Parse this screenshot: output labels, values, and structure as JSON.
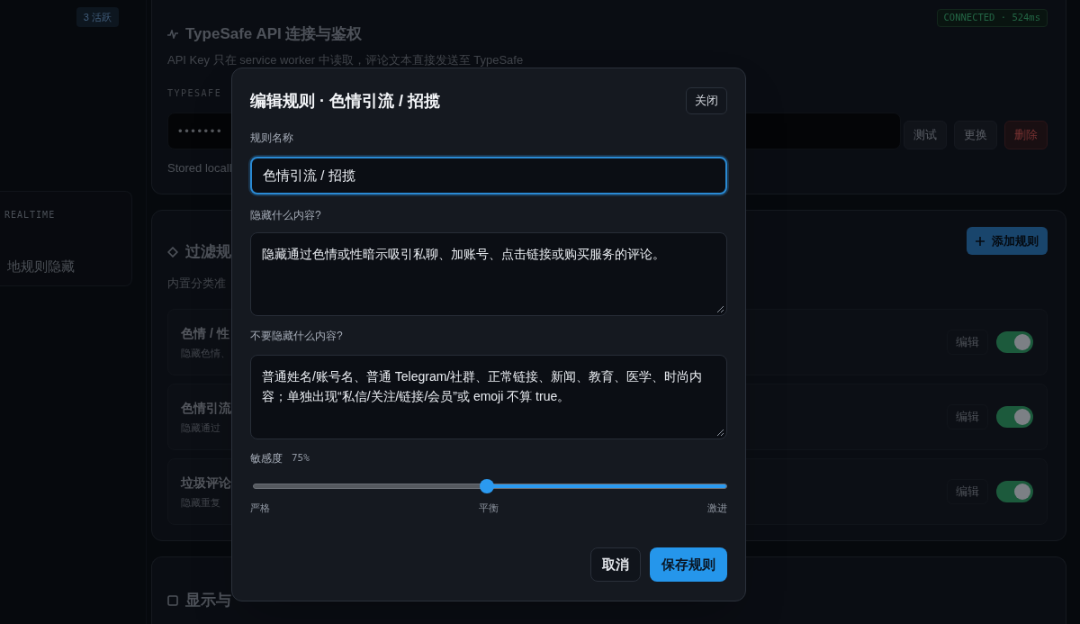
{
  "sidebar": {
    "badge": "3 活跃",
    "card": {
      "tag": "REALTIME",
      "title": "地规则隐藏"
    }
  },
  "api_card": {
    "title": "TypeSafe API 连接与鉴权",
    "status": "CONNECTED · 524ms",
    "description": "API Key 只在 service worker 中读取，评论文本直接发送至 TypeSafe",
    "key_label": "TYPESAFE",
    "key_value": "•••••••",
    "buttons": [
      {
        "label": "测试",
        "kind": "default"
      },
      {
        "label": "更换",
        "kind": "default"
      },
      {
        "label": "删除",
        "kind": "danger"
      }
    ],
    "note": "Stored locall"
  },
  "rules_card": {
    "title": "过滤规",
    "description": "内置分类准",
    "add_button": "添加规则",
    "rules": [
      {
        "title": "色情 / 性",
        "summary": "隐藏色情、",
        "edit": "编辑",
        "on": true
      },
      {
        "title": "色情引流",
        "summary": "隐藏通过",
        "edit": "编辑",
        "on": true
      },
      {
        "title": "垃圾评论",
        "summary": "隐藏重复",
        "edit": "编辑",
        "on": true
      }
    ]
  },
  "display_card": {
    "title": "显示与"
  },
  "dialog": {
    "title": "编辑规则 · 色情引流 / 招揽",
    "close": "关闭",
    "fields": [
      {
        "kind": "input",
        "label": "规则名称",
        "value": "色情引流 / 招揽",
        "focused": true
      },
      {
        "kind": "textarea",
        "label": "隐藏什么内容?",
        "value": "隐藏通过色情或性暗示吸引私聊、加账号、点击链接或购买服务的评论。",
        "focused": false
      },
      {
        "kind": "textarea",
        "label": "不要隐藏什么内容?",
        "value": "普通姓名/账号名、普通 Telegram/社群、正常链接、新闻、教育、医学、时尚内容；单独出现“私信/关注/链接/会员”或 emoji 不算 true。",
        "focused": false
      }
    ],
    "sensitivity": {
      "label": "敏感度",
      "reading": "75%",
      "level": 0.49,
      "marks": [
        "严格",
        "平衡",
        "激进"
      ]
    },
    "buttons": [
      {
        "label": "取消",
        "kind": "secondary"
      },
      {
        "label": "保存规则",
        "kind": "primary"
      }
    ]
  }
}
